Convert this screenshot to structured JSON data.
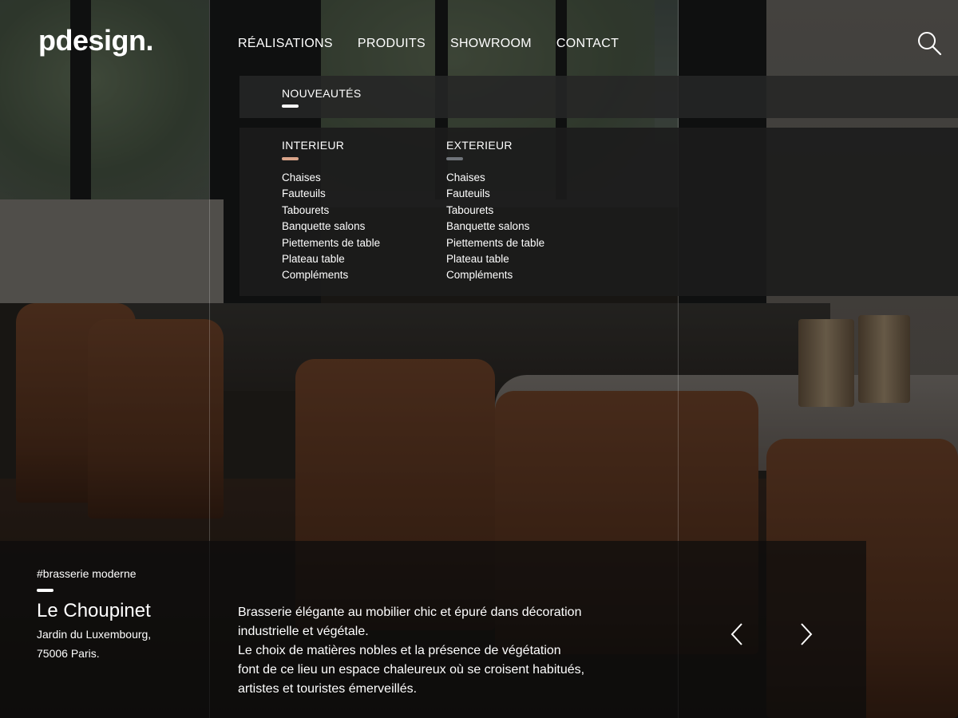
{
  "brand": {
    "logo": "pdesign."
  },
  "nav": {
    "items": [
      "RÉALISATIONS",
      "PRODUITS",
      "SHOWROOM",
      "CONTACT"
    ]
  },
  "menu": {
    "strip_title": "NOUVEAUTÉS",
    "columns": [
      {
        "title": "INTERIEUR",
        "accent": "#d9a48a",
        "items": [
          "Chaises",
          "Fauteuils",
          "Tabourets",
          "Banquette salons",
          "Piettements de table",
          "Plateau table",
          "Compléments"
        ]
      },
      {
        "title": "EXTERIEUR",
        "accent": "#6f747a",
        "items": [
          "Chaises",
          "Fauteuils",
          "Tabourets",
          "Banquette salons",
          "Piettements de table",
          "Plateau table",
          "Compléments"
        ]
      }
    ]
  },
  "project": {
    "tag": "#brasserie moderne",
    "name": "Le Choupinet",
    "address_line1": "Jardin du Luxembourg,",
    "address_line2": "75006 Paris.",
    "description_line1": "Brasserie élégante au mobilier chic et épuré dans décoration",
    "description_line2": "industrielle et végétale.",
    "description_line3": "Le choix de matières nobles et la présence de végétation",
    "description_line4": "font de ce lieu un espace chaleureux où se croisent habitués,",
    "description_line5": "artistes et touristes émerveillés."
  },
  "icons": {
    "search": "search-icon",
    "prev": "chevron-left-icon",
    "next": "chevron-right-icon"
  },
  "colors": {
    "accent_underline": "#ffffff"
  }
}
